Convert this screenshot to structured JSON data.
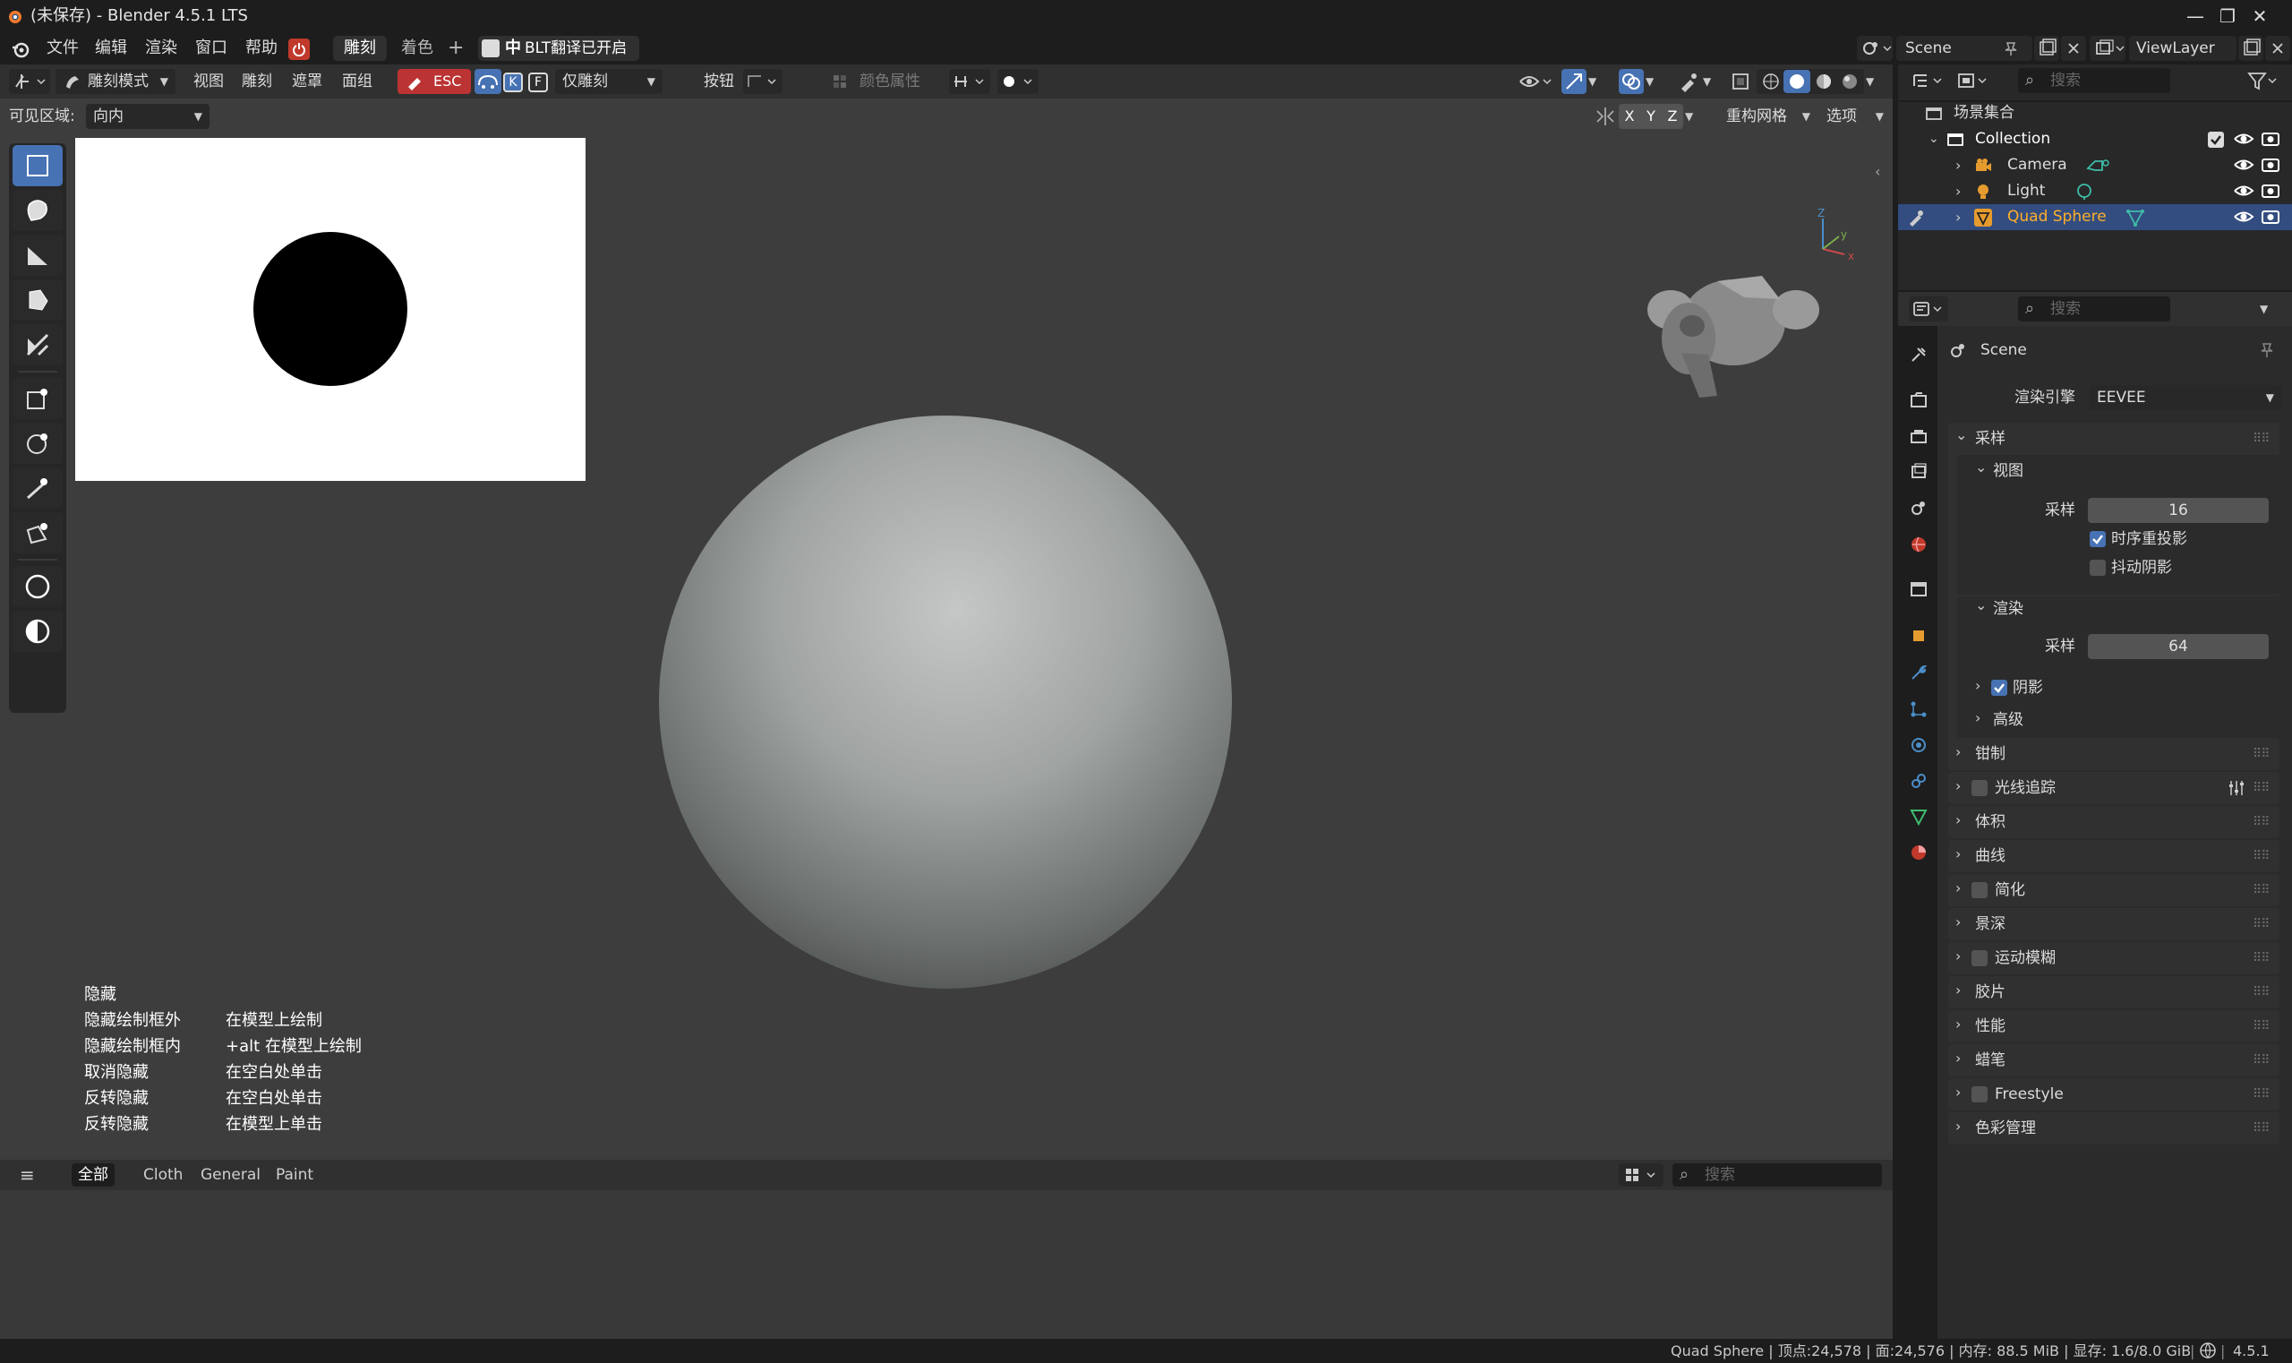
{
  "window": {
    "title": "(未保存) - Blender 4.5.1 LTS",
    "minimize": "—",
    "maximize": "❐",
    "close": "✕"
  },
  "menubar": {
    "menus": [
      "文件",
      "编辑",
      "渲染",
      "窗口",
      "帮助"
    ],
    "workspace_tabs": [
      "雕刻",
      "着色"
    ],
    "add_tab": "+",
    "translate_badge": "中",
    "translate_text": "BLT翻译已开启",
    "scene_name": "Scene",
    "view_layer": "ViewLayer"
  },
  "viewport_header": {
    "mode": "雕刻模式",
    "menus": [
      "视图",
      "雕刻",
      "遮罩",
      "面组"
    ],
    "esc": "ESC",
    "key_k": "K",
    "key_f": "F",
    "sculpt_only": "仅雕刻",
    "button": "按钮",
    "color_attr": "颜色属性",
    "visible_area_label": "可见区域:",
    "visible_area_value": "向内",
    "axis_x": "X",
    "axis_y": "Y",
    "axis_z": "Z",
    "remesh": "重构网格",
    "options": "选项"
  },
  "hints": [
    {
      "left": "隐藏",
      "right": ""
    },
    {
      "left": "隐藏绘制框外",
      "right": "在模型上绘制"
    },
    {
      "left": "隐藏绘制框内",
      "right": "+alt 在模型上绘制"
    },
    {
      "left": "取消隐藏",
      "right": "在空白处单击"
    },
    {
      "left": "反转隐藏",
      "right": "在空白处单击"
    },
    {
      "left": "反转隐藏",
      "right": "在模型上单击"
    }
  ],
  "asset_bar": {
    "tabs": [
      "全部",
      "Cloth",
      "General",
      "Paint"
    ],
    "search_placeholder": "搜索"
  },
  "outliner": {
    "search_placeholder": "搜索",
    "scene_collection": "场景集合",
    "collection": "Collection",
    "items": [
      "Camera",
      "Light",
      "Quad Sphere"
    ]
  },
  "properties": {
    "search_placeholder": "搜索",
    "context": "Scene",
    "render_engine_label": "渲染引擎",
    "render_engine": "EEVEE",
    "sampling": {
      "title": "采样",
      "viewport": "视图",
      "viewport_samples_label": "采样",
      "viewport_samples": "16",
      "temporal_reprojection": "时序重投影",
      "jitter_shadows": "抖动阴影",
      "render": "渲染",
      "render_samples_label": "采样",
      "render_samples": "64",
      "shadows": "阴影",
      "advanced": "高级"
    },
    "panels": [
      "钳制",
      "光线追踪",
      "体积",
      "曲线",
      "简化",
      "景深",
      "运动模糊",
      "胶片",
      "性能",
      "蜡笔",
      "Freestyle",
      "色彩管理"
    ]
  },
  "statusbar": {
    "text": "Quad Sphere | 顶点:24,578 | 面:24,576 | 内存: 88.5 MiB | 显存: 1.6/8.0 GiB",
    "version": "4.5.1"
  },
  "colors": {
    "accent": "#4772b3",
    "selected_object": "#ffaf29",
    "viewport_bg": "#3d3d3d",
    "esc_chip": "#bb3333"
  }
}
